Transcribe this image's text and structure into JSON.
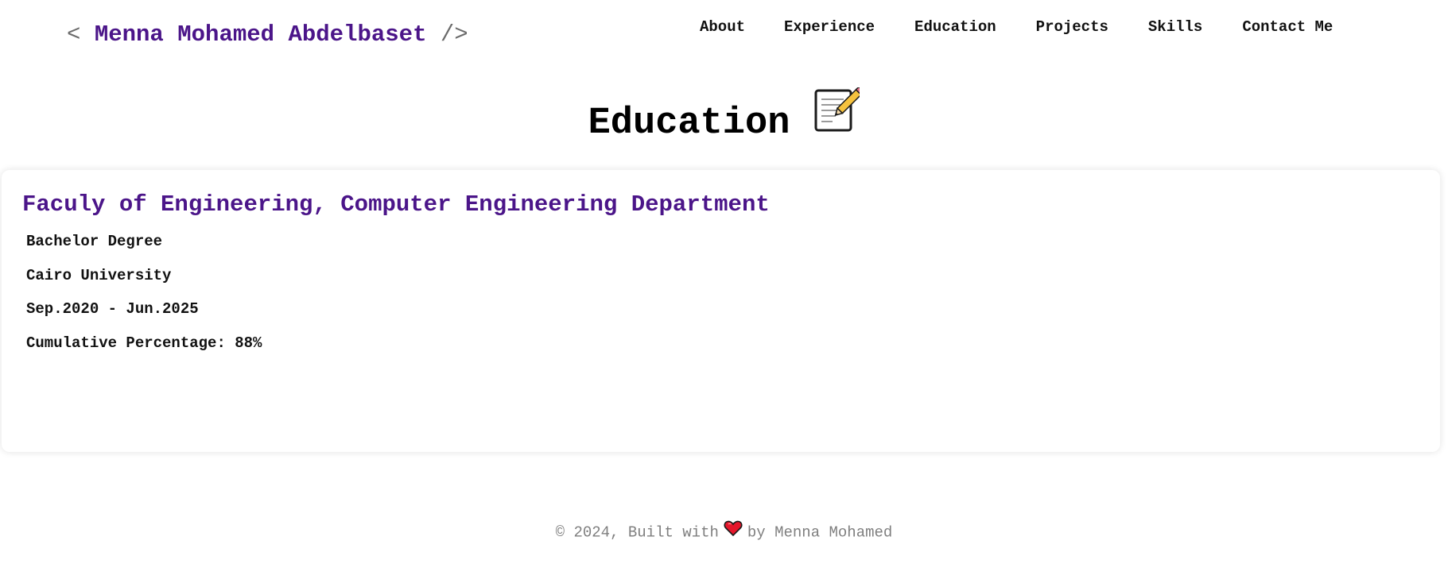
{
  "header": {
    "brand_open": "<",
    "brand_name": "Menna Mohamed Abdelbaset",
    "brand_close": "/>",
    "nav": [
      {
        "label": "About"
      },
      {
        "label": "Experience"
      },
      {
        "label": "Education"
      },
      {
        "label": "Projects"
      },
      {
        "label": "Skills"
      },
      {
        "label": "Contact Me"
      }
    ]
  },
  "main": {
    "section_title": "Education",
    "section_icon": "memo-pencil-icon",
    "education": {
      "institution_title": "Faculy of Engineering, Computer Engineering Department",
      "degree": "Bachelor Degree",
      "university": "Cairo University",
      "period": "Sep.2020 - Jun.2025",
      "grade": "Cumulative Percentage: 88%"
    }
  },
  "footer": {
    "prefix": "© 2024, Built with",
    "heart_icon": "heart-icon",
    "suffix": "by Menna Mohamed"
  },
  "colors": {
    "accent_purple": "#4b1589",
    "footer_gray": "#7f7f7f",
    "heart_red": "#e5162b"
  }
}
